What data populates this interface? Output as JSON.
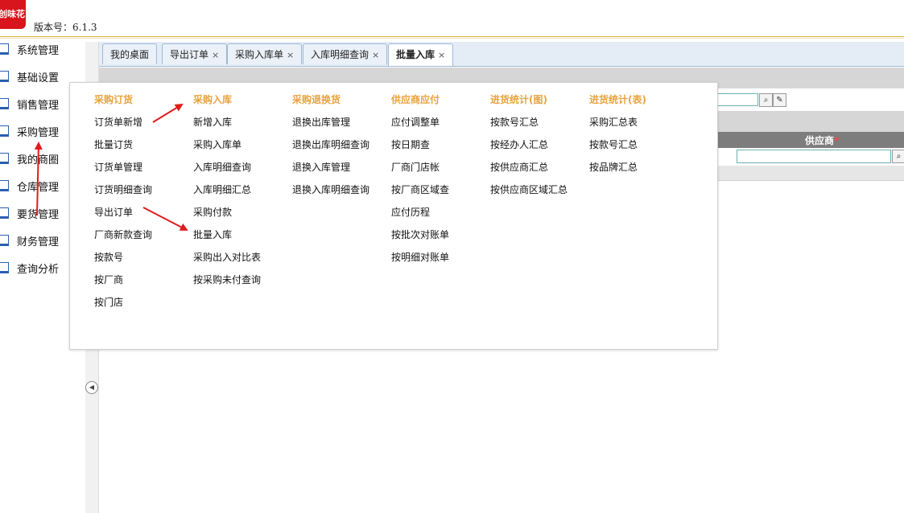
{
  "header": {
    "logo_text": "创味花",
    "version_label": "版本号：6.1.3"
  },
  "sidebar": {
    "items": [
      {
        "label": "系统管理"
      },
      {
        "label": "基础设置"
      },
      {
        "label": "销售管理"
      },
      {
        "label": "采购管理"
      },
      {
        "label": "我的商圈"
      },
      {
        "label": "仓库管理"
      },
      {
        "label": "要货管理"
      },
      {
        "label": "财务管理"
      },
      {
        "label": "查询分析"
      }
    ]
  },
  "tabs": [
    {
      "label": "我的桌面",
      "closable": false
    },
    {
      "label": "导出订单",
      "closable": true
    },
    {
      "label": "采购入库单",
      "closable": true
    },
    {
      "label": "入库明细查询",
      "closable": true
    },
    {
      "label": "批量入库",
      "closable": true,
      "active": true
    }
  ],
  "close_glyph": "×",
  "grid": {
    "supplier_header": "供应商",
    "required_mark": "*"
  },
  "mega_menu": {
    "columns": [
      {
        "title": "采购订货",
        "items": [
          "订货单新增",
          "批量订货",
          "订货单管理",
          "订货明细查询",
          "导出订单",
          "厂商新款查询",
          "按款号",
          "按厂商",
          "按门店"
        ]
      },
      {
        "title": "采购入库",
        "items": [
          "新增入库",
          "采购入库单",
          "入库明细查询",
          "入库明细汇总",
          "采购付款",
          "批量入库",
          "采购出入对比表",
          "按采购未付查询"
        ]
      },
      {
        "title": "采购退换货",
        "items": [
          "退换出库管理",
          "退换出库明细查询",
          "退换入库管理",
          "退换入库明细查询"
        ]
      },
      {
        "title": "供应商应付",
        "items": [
          "应付调整单",
          "按日期查",
          "厂商门店帐",
          "按厂商区域查",
          "应付历程",
          "按批次对账单",
          "按明细对账单"
        ]
      },
      {
        "title": "进货统计(图)",
        "items": [
          "按款号汇总",
          "按经办人汇总",
          "按供应商汇总",
          "按供应商区域汇总"
        ]
      },
      {
        "title": "进货统计(表)",
        "items": [
          "采购汇总表",
          "按款号汇总",
          "按品牌汇总"
        ]
      }
    ]
  },
  "colors": {
    "accent_orange": "#e8a33d",
    "annotation_red": "#e01b1b",
    "logo_red": "#d8141c"
  },
  "icons": {
    "search": "search-icon",
    "edit": "edit-icon",
    "collapse": "chevron-left-icon"
  }
}
